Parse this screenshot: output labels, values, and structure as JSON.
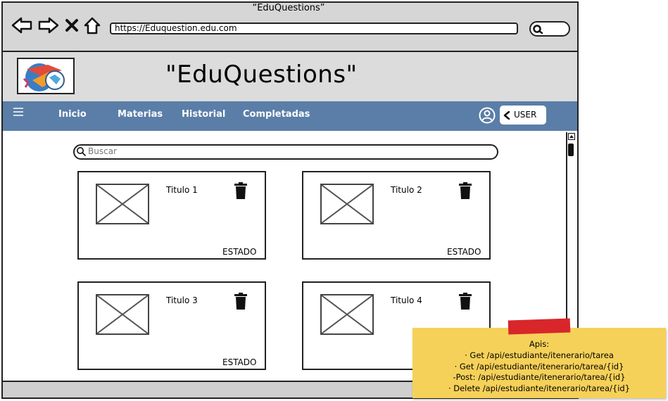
{
  "browser": {
    "window_title": "“EduQuestions”",
    "url": "https://Eduquestion.edu.com"
  },
  "app": {
    "title": "\"EduQuestions\""
  },
  "nav": {
    "items": [
      "Inicio",
      "Materias",
      "Historial",
      "Completadas"
    ],
    "user_label": "USER"
  },
  "search": {
    "placeholder": "Buscar"
  },
  "cards": [
    {
      "title": "Titulo 1",
      "status": "ESTADO"
    },
    {
      "title": "Titulo 2",
      "status": "ESTADO"
    },
    {
      "title": "Titulo 3",
      "status": "ESTADO"
    },
    {
      "title": "Titulo 4",
      "status": ""
    }
  ],
  "note": {
    "heading": "Apis:",
    "lines": [
      "·  Get /api/estudiante/itenerario/tarea",
      "·  Get /api/estudiante/itenerario/tarea/{id}",
      "-Post: /api/estudiante/itenerario/tarea/{id}",
      "·  Delete /api/estudiante/itenerario/tarea/{id}"
    ]
  },
  "colors": {
    "navbar": "#5a7ea8",
    "header": "#dcdcdc",
    "chrome": "#d6d6d6",
    "note": "#f6d159",
    "tape": "#d9262b"
  },
  "icons": {
    "back": "back-arrow-icon",
    "forward": "forward-arrow-icon",
    "close": "close-icon",
    "home": "home-icon",
    "search": "search-icon",
    "menu": "hamburger-menu-icon",
    "user": "user-circle-icon",
    "chevron": "chevron-left-icon",
    "delete": "trash-icon",
    "image": "image-placeholder-icon"
  }
}
